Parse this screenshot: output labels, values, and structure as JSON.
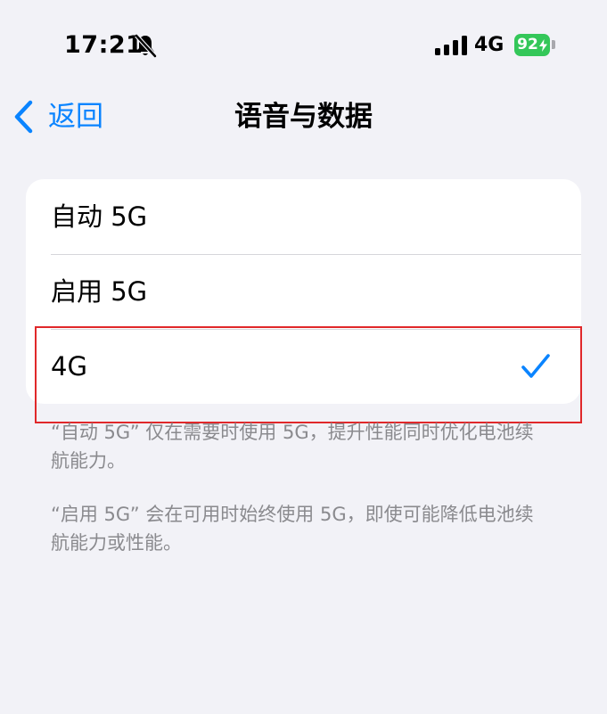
{
  "status_bar": {
    "time": "17:21",
    "network": "4G",
    "battery": "92"
  },
  "nav": {
    "back_label": "返回",
    "title": "语音与数据"
  },
  "options": [
    {
      "label": "自动 5G",
      "selected": false
    },
    {
      "label": "启用 5G",
      "selected": false
    },
    {
      "label": "4G",
      "selected": true
    }
  ],
  "footnotes": [
    "“自动 5G” 仅在需要时使用 5G，提升性能同时优化电池续航能力。",
    "“启用 5G” 会在可用时始终使用 5G，即使可能降低电池续航能力或性能。"
  ],
  "colors": {
    "accent": "#0a84ff",
    "background": "#f2f2f7",
    "battery": "#34c759",
    "highlight": "#e0282a"
  }
}
